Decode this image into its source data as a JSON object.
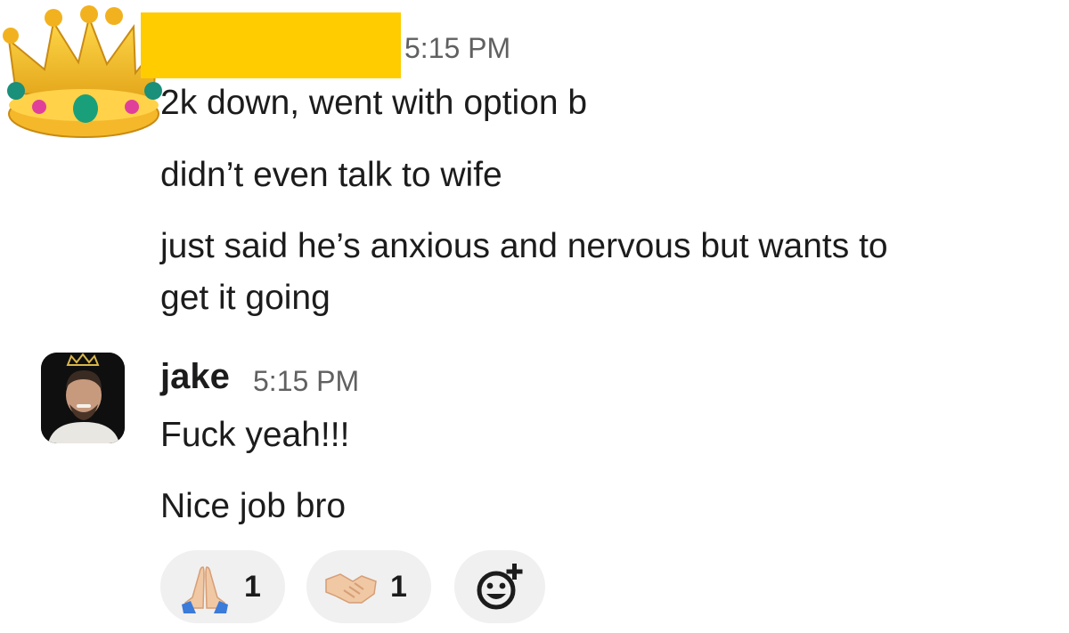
{
  "message_group_1": {
    "timestamp": "5:15 PM",
    "lines": [
      "2k down, went with option b",
      "didn’t even talk to wife",
      "just said he’s anxious and nervous but wants to",
      "get it going"
    ],
    "avatar_icon": "crown-emoji",
    "redaction_color": "#ffcc00"
  },
  "message_group_2": {
    "username": "jake",
    "timestamp": "5:15 PM",
    "avatar_icon": "user-photo-with-crown",
    "lines": [
      "Fuck yeah!!!",
      "Nice job bro"
    ]
  },
  "reactions": [
    {
      "emoji": "folded-hands",
      "count": "1"
    },
    {
      "emoji": "handshake",
      "count": "1"
    }
  ],
  "add_reaction_icon": "add-emoji-icon"
}
